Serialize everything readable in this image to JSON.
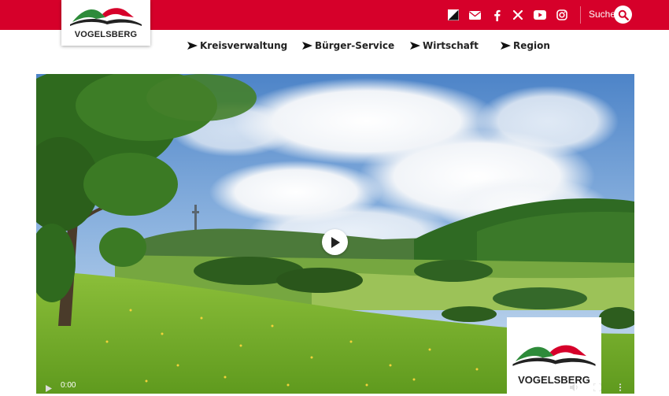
{
  "header": {
    "brand_color": "#d6002a",
    "logo_text": "VOGELSBERG",
    "social_icons": [
      "contrast-icon",
      "mail-icon",
      "facebook-icon",
      "x-icon",
      "youtube-icon",
      "instagram-icon"
    ],
    "search_label": "Suche"
  },
  "nav": {
    "items": [
      {
        "label": "Kreisverwaltung"
      },
      {
        "label": "Bürger-Service"
      },
      {
        "label": "Wirtschaft"
      },
      {
        "label": "Region"
      }
    ]
  },
  "video": {
    "current_time": "0:00",
    "overlay_logo_text": "VOGELSBERG"
  }
}
